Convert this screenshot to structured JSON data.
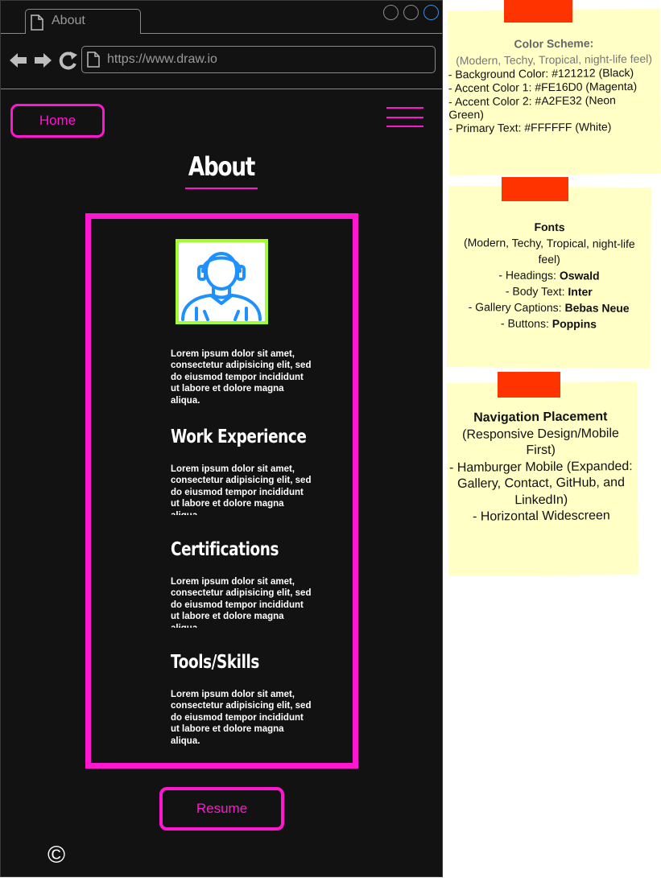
{
  "browser": {
    "tab_title": "About",
    "url": "https://www.draw.io"
  },
  "nav": {
    "home_label": "Home"
  },
  "page": {
    "title": "About",
    "intro": "Lorem ipsum dolor sit amet, consectetur adipisicing elit, sed do eiusmod tempor incididunt ut labore et dolore magna aliqua.",
    "sections": [
      {
        "heading": "Work Experience",
        "text": "Lorem ipsum dolor sit amet, consectetur adipisicing elit, sed do eiusmod tempor incididunt ut labore et dolore magna aliqua."
      },
      {
        "heading": "Certifications",
        "text": "Lorem ipsum dolor sit amet, consectetur adipisicing elit, sed do eiusmod tempor incididunt ut labore et dolore magna aliqua."
      },
      {
        "heading": "Tools/Skills",
        "text": "Lorem ipsum dolor sit amet, consectetur adipisicing elit, sed do eiusmod tempor incididunt ut labore et dolore magna aliqua."
      }
    ],
    "resume_label": "Resume",
    "copyright": "©"
  },
  "notes": {
    "color_scheme": {
      "title": "Color Scheme:",
      "subtitle": "(Modern, Techy, Tropical, night-life feel)",
      "lines": [
        "- Background Color: #121212 (Black)",
        "- Accent Color 1: #FE16D0 (Magenta)",
        "- Accent Color 2: #A2FE32 (Neon Green)",
        "- Primary Text: #FFFFFF (White)"
      ]
    },
    "fonts": {
      "title": "Fonts",
      "subtitle": "(Modern, Techy, Tropical, night-life feel)",
      "items": [
        {
          "label": "- Headings: ",
          "value": "Oswald"
        },
        {
          "label": "- Body Text: ",
          "value": "Inter"
        },
        {
          "label": "- Gallery Captions: ",
          "value": "Bebas Neue"
        },
        {
          "label": "- Buttons: ",
          "value": "Poppins"
        }
      ]
    },
    "navigation": {
      "title": "Navigation Placement",
      "subtitle": "(Responsive Design/Mobile First)",
      "lines": [
        "- Hamburger Mobile (Expanded: Gallery, Contact, GitHub, and LinkedIn)",
        "- Horizontal Widescreen"
      ]
    }
  },
  "colors": {
    "background": "#121212",
    "accent1": "#FE16D0",
    "accent2": "#A2FE32",
    "text": "#FFFFFF",
    "note": "#FFFFC6",
    "tape": "#FF3300"
  },
  "icons": [
    "page-icon",
    "back-arrow-icon",
    "forward-arrow-icon",
    "reload-icon",
    "hamburger-menu-icon",
    "user-avatar-icon"
  ]
}
